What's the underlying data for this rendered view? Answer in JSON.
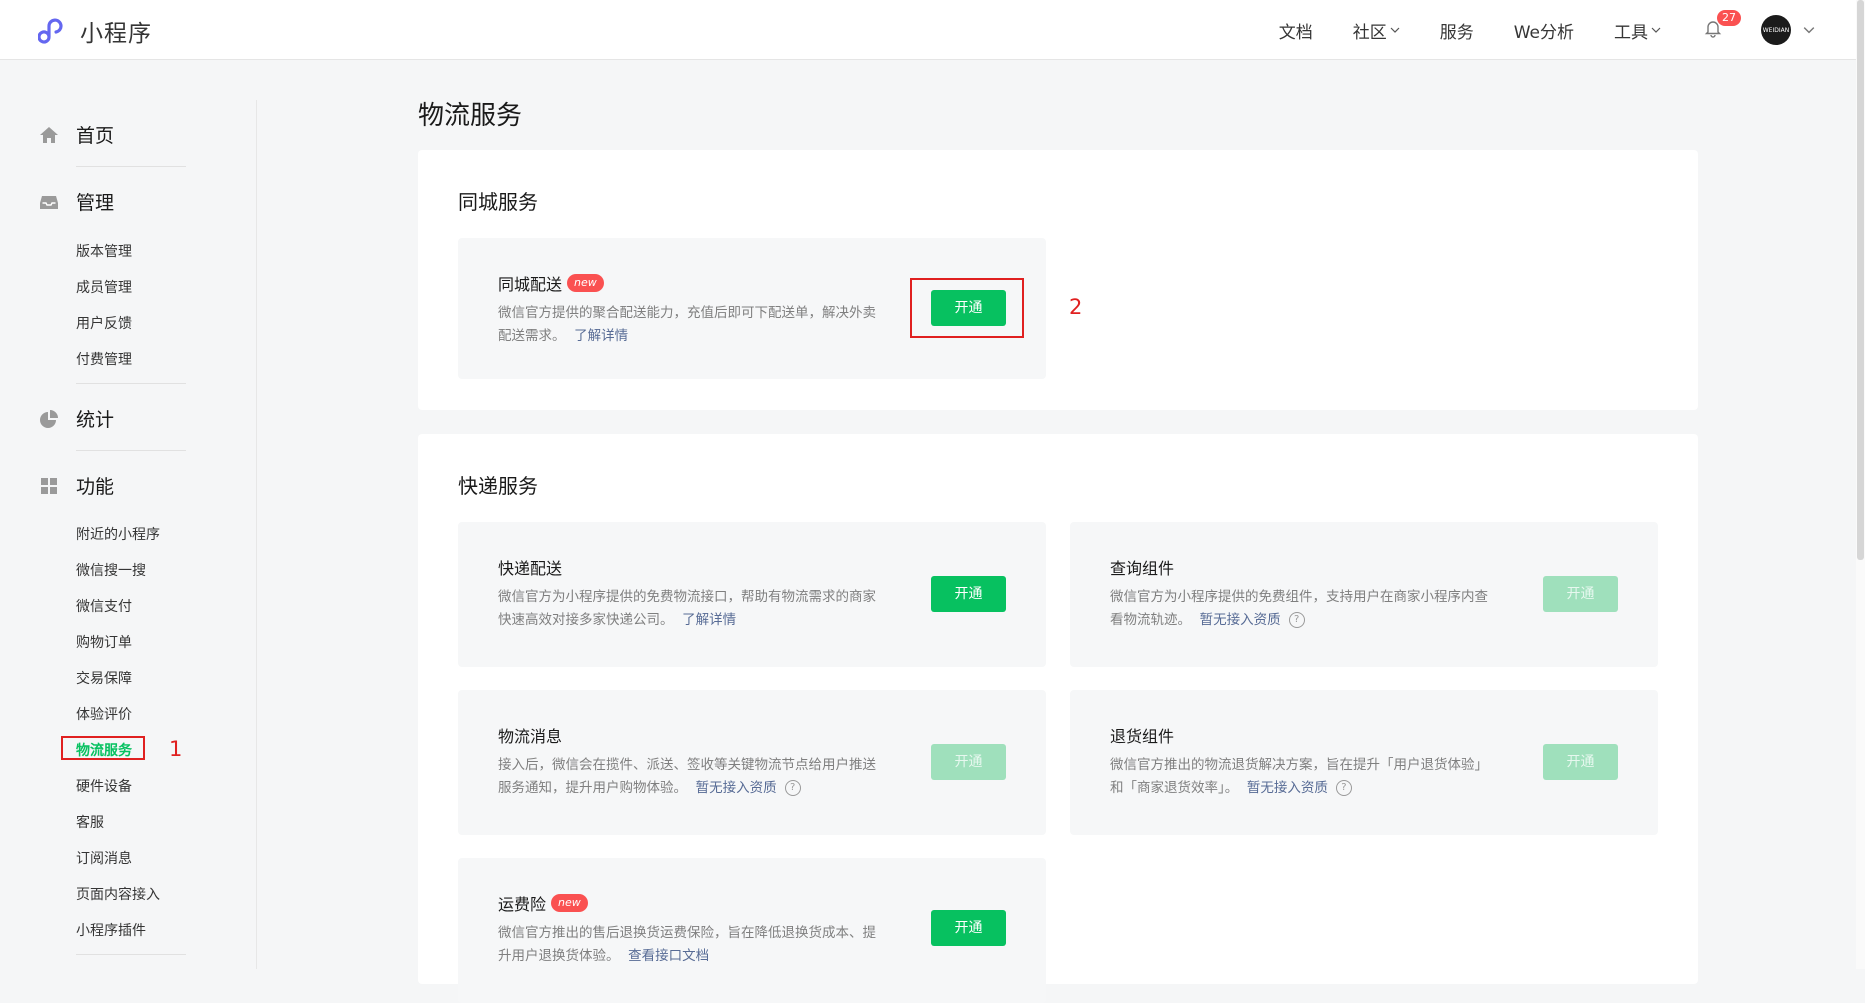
{
  "app": {
    "title": "小程序"
  },
  "topnav": {
    "items": [
      "文档",
      "社区",
      "服务",
      "We分析",
      "工具"
    ],
    "notification_count": "27",
    "avatar_text": "WEIDIAN"
  },
  "sidebar": {
    "groups": [
      {
        "label": "首页",
        "icon": "home-icon"
      },
      {
        "label": "管理",
        "icon": "inbox-icon",
        "items": [
          "版本管理",
          "成员管理",
          "用户反馈",
          "付费管理"
        ]
      },
      {
        "label": "统计",
        "icon": "pie-chart-icon"
      },
      {
        "label": "功能",
        "icon": "grid-icon",
        "items": [
          "附近的小程序",
          "微信搜一搜",
          "微信支付",
          "购物订单",
          "交易保障",
          "体验评价",
          "物流服务",
          "硬件设备",
          "客服",
          "订阅消息",
          "页面内容接入",
          "小程序插件"
        ]
      }
    ],
    "active_item": "物流服务"
  },
  "annotations": {
    "marker1": "1",
    "marker2": "2"
  },
  "page": {
    "title": "物流服务"
  },
  "sections": [
    {
      "title": "同城服务",
      "cards": [
        {
          "title": "同城配送",
          "badge": "new",
          "desc": "微信官方提供的聚合配送能力，充值后即可下配送单，解决外卖配送需求。",
          "link": "了解详情",
          "button": "开通",
          "enabled": true
        }
      ]
    },
    {
      "title": "快递服务",
      "cards": [
        {
          "title": "快递配送",
          "desc": "微信官方为小程序提供的免费物流接口，帮助有物流需求的商家快速高效对接多家快递公司。",
          "link": "了解详情",
          "button": "开通",
          "enabled": true
        },
        {
          "title": "查询组件",
          "desc": "微信官方为小程序提供的免费组件，支持用户在商家小程序内查看物流轨迹。",
          "link": "暂无接入资质",
          "help": "?",
          "button": "开通",
          "enabled": false
        },
        {
          "title": "物流消息",
          "desc": "接入后，微信会在揽件、派送、签收等关键物流节点给用户推送服务通知，提升用户购物体验。",
          "link": "暂无接入资质",
          "help": "?",
          "button": "开通",
          "enabled": false
        },
        {
          "title": "退货组件",
          "desc": "微信官方推出的物流退货解决方案，旨在提升「用户退货体验」和「商家退货效率」。",
          "link": "暂无接入资质",
          "help": "?",
          "button": "开通",
          "enabled": false
        },
        {
          "title": "运费险",
          "badge": "new",
          "desc": "微信官方推出的售后退换货运费保险，旨在降低退换货成本、提升用户退换货体验。",
          "link": "查看接口文档",
          "button": "开通",
          "enabled": true
        }
      ]
    }
  ],
  "colors": {
    "brand_green": "#07c160",
    "disabled_green": "#9fe0bc",
    "highlight_red": "#e02020",
    "link_blue": "#576b95"
  }
}
